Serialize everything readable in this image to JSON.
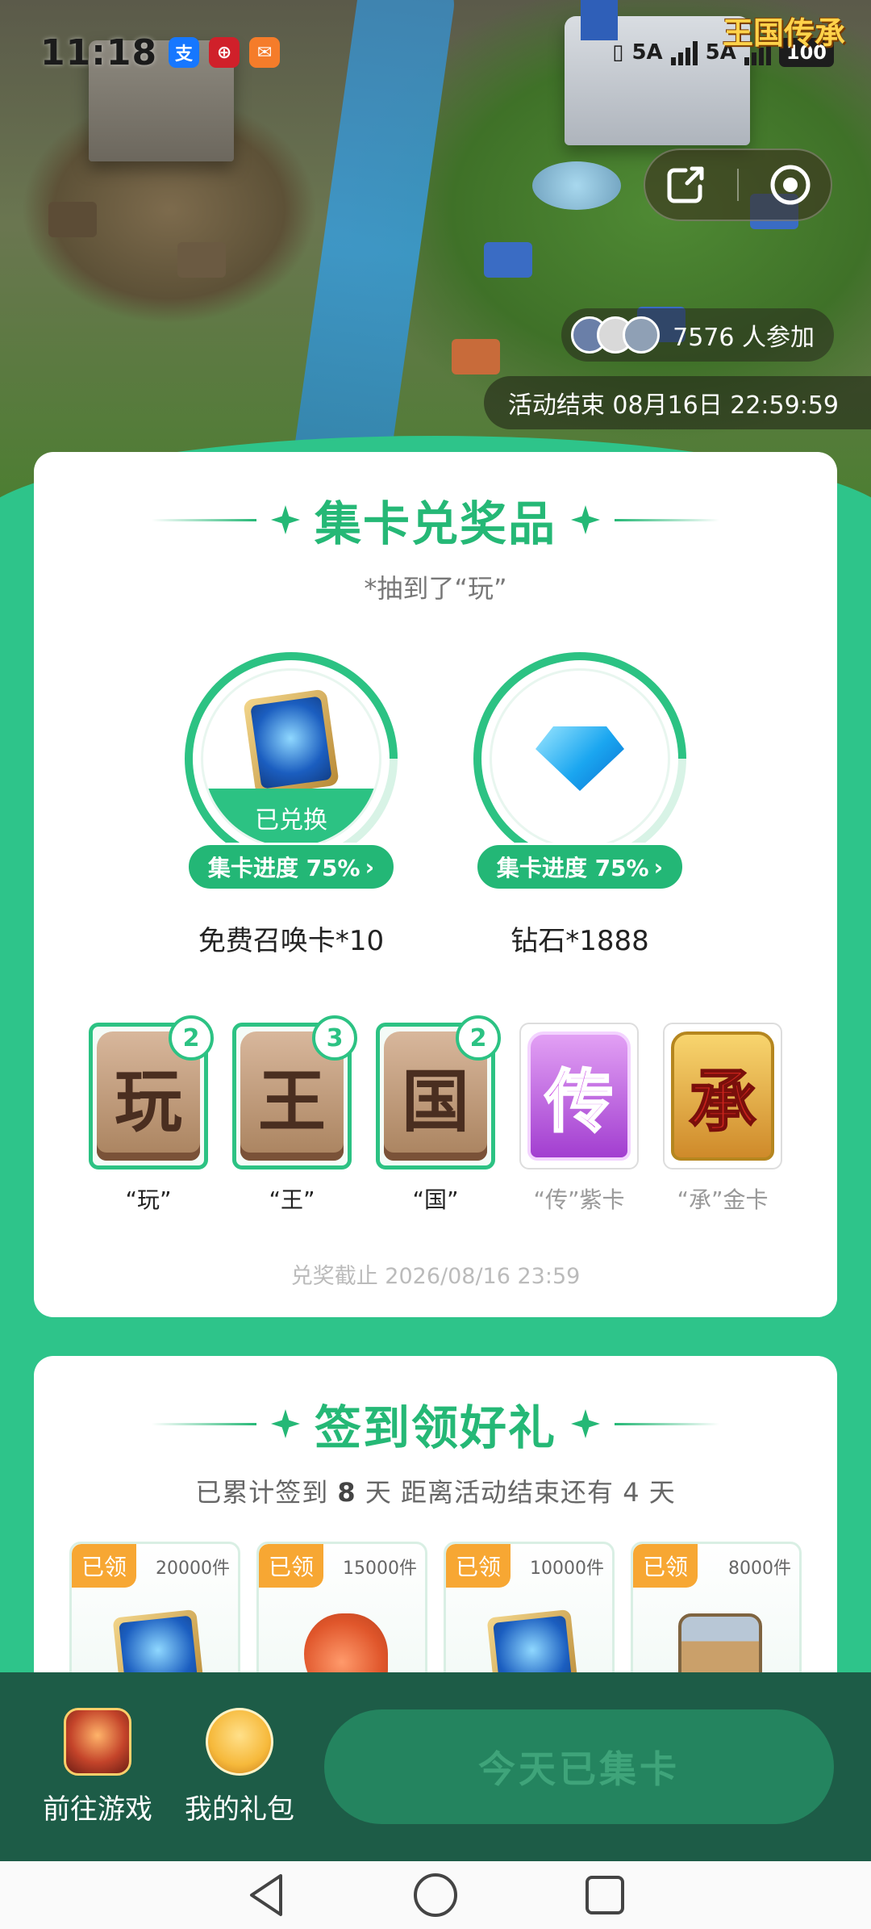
{
  "status_bar": {
    "time": "11:18",
    "app_icons": [
      {
        "name": "alipay-icon",
        "glyph": "支",
        "color": "#1677ff"
      },
      {
        "name": "bank-icon",
        "glyph": "⊕",
        "color": "#d0202a"
      },
      {
        "name": "message-icon",
        "glyph": "✉",
        "color": "#f57c2a"
      }
    ],
    "network_labels": [
      "5A",
      "5A"
    ],
    "battery": "100"
  },
  "hero": {
    "game_logo": "王国传承",
    "participants_count": "7576 人参加",
    "end_time": "活动结束 08月16日 22:59:59"
  },
  "collect_section": {
    "title": "集卡兑奖品",
    "subtitle": "*抽到了“玩”",
    "prizes": [
      {
        "name": "免费召唤卡*10",
        "progress_label": "集卡进度 75%",
        "progress": 0.75,
        "redeemed_label": "已兑换"
      },
      {
        "name": "钻石*1888",
        "progress_label": "集卡进度 75%",
        "progress": 0.75
      }
    ],
    "letters": [
      {
        "glyph": "玩",
        "label": "“玩”",
        "count": "2",
        "owned": true
      },
      {
        "glyph": "王",
        "label": "“王”",
        "count": "3",
        "owned": true
      },
      {
        "glyph": "国",
        "label": "“国”",
        "count": "2",
        "owned": true
      },
      {
        "glyph": "传",
        "label": "“传”紫卡",
        "owned": false
      },
      {
        "glyph": "承",
        "label": "“承”金卡",
        "owned": false
      }
    ],
    "deadline": "兑奖截止 2026/08/16 23:59"
  },
  "checkin_section": {
    "title": "签到领好礼",
    "sub_prefix": "已累计签到",
    "days_signed": "8",
    "sub_mid": "天  距离活动结束还有",
    "days_left": "4",
    "sub_suffix": "天",
    "rewards": [
      {
        "tag": "已领",
        "count": "20000件",
        "icon": "summon-card-icon"
      },
      {
        "tag": "已领",
        "count": "15000件",
        "icon": "meat-icon"
      },
      {
        "tag": "已领",
        "count": "10000件",
        "icon": "summon-card-icon"
      },
      {
        "tag": "已领",
        "count": "8000件",
        "icon": "treasure-chest-icon"
      }
    ]
  },
  "action_bar": {
    "go_game": "前往游戏",
    "my_gifts": "我的礼包",
    "collect_button": "今天已集卡"
  },
  "colors": {
    "accent": "#2cc283",
    "background": "#2ec48a",
    "action_bar": "#1d5c47",
    "tag_orange": "#f7a733"
  }
}
